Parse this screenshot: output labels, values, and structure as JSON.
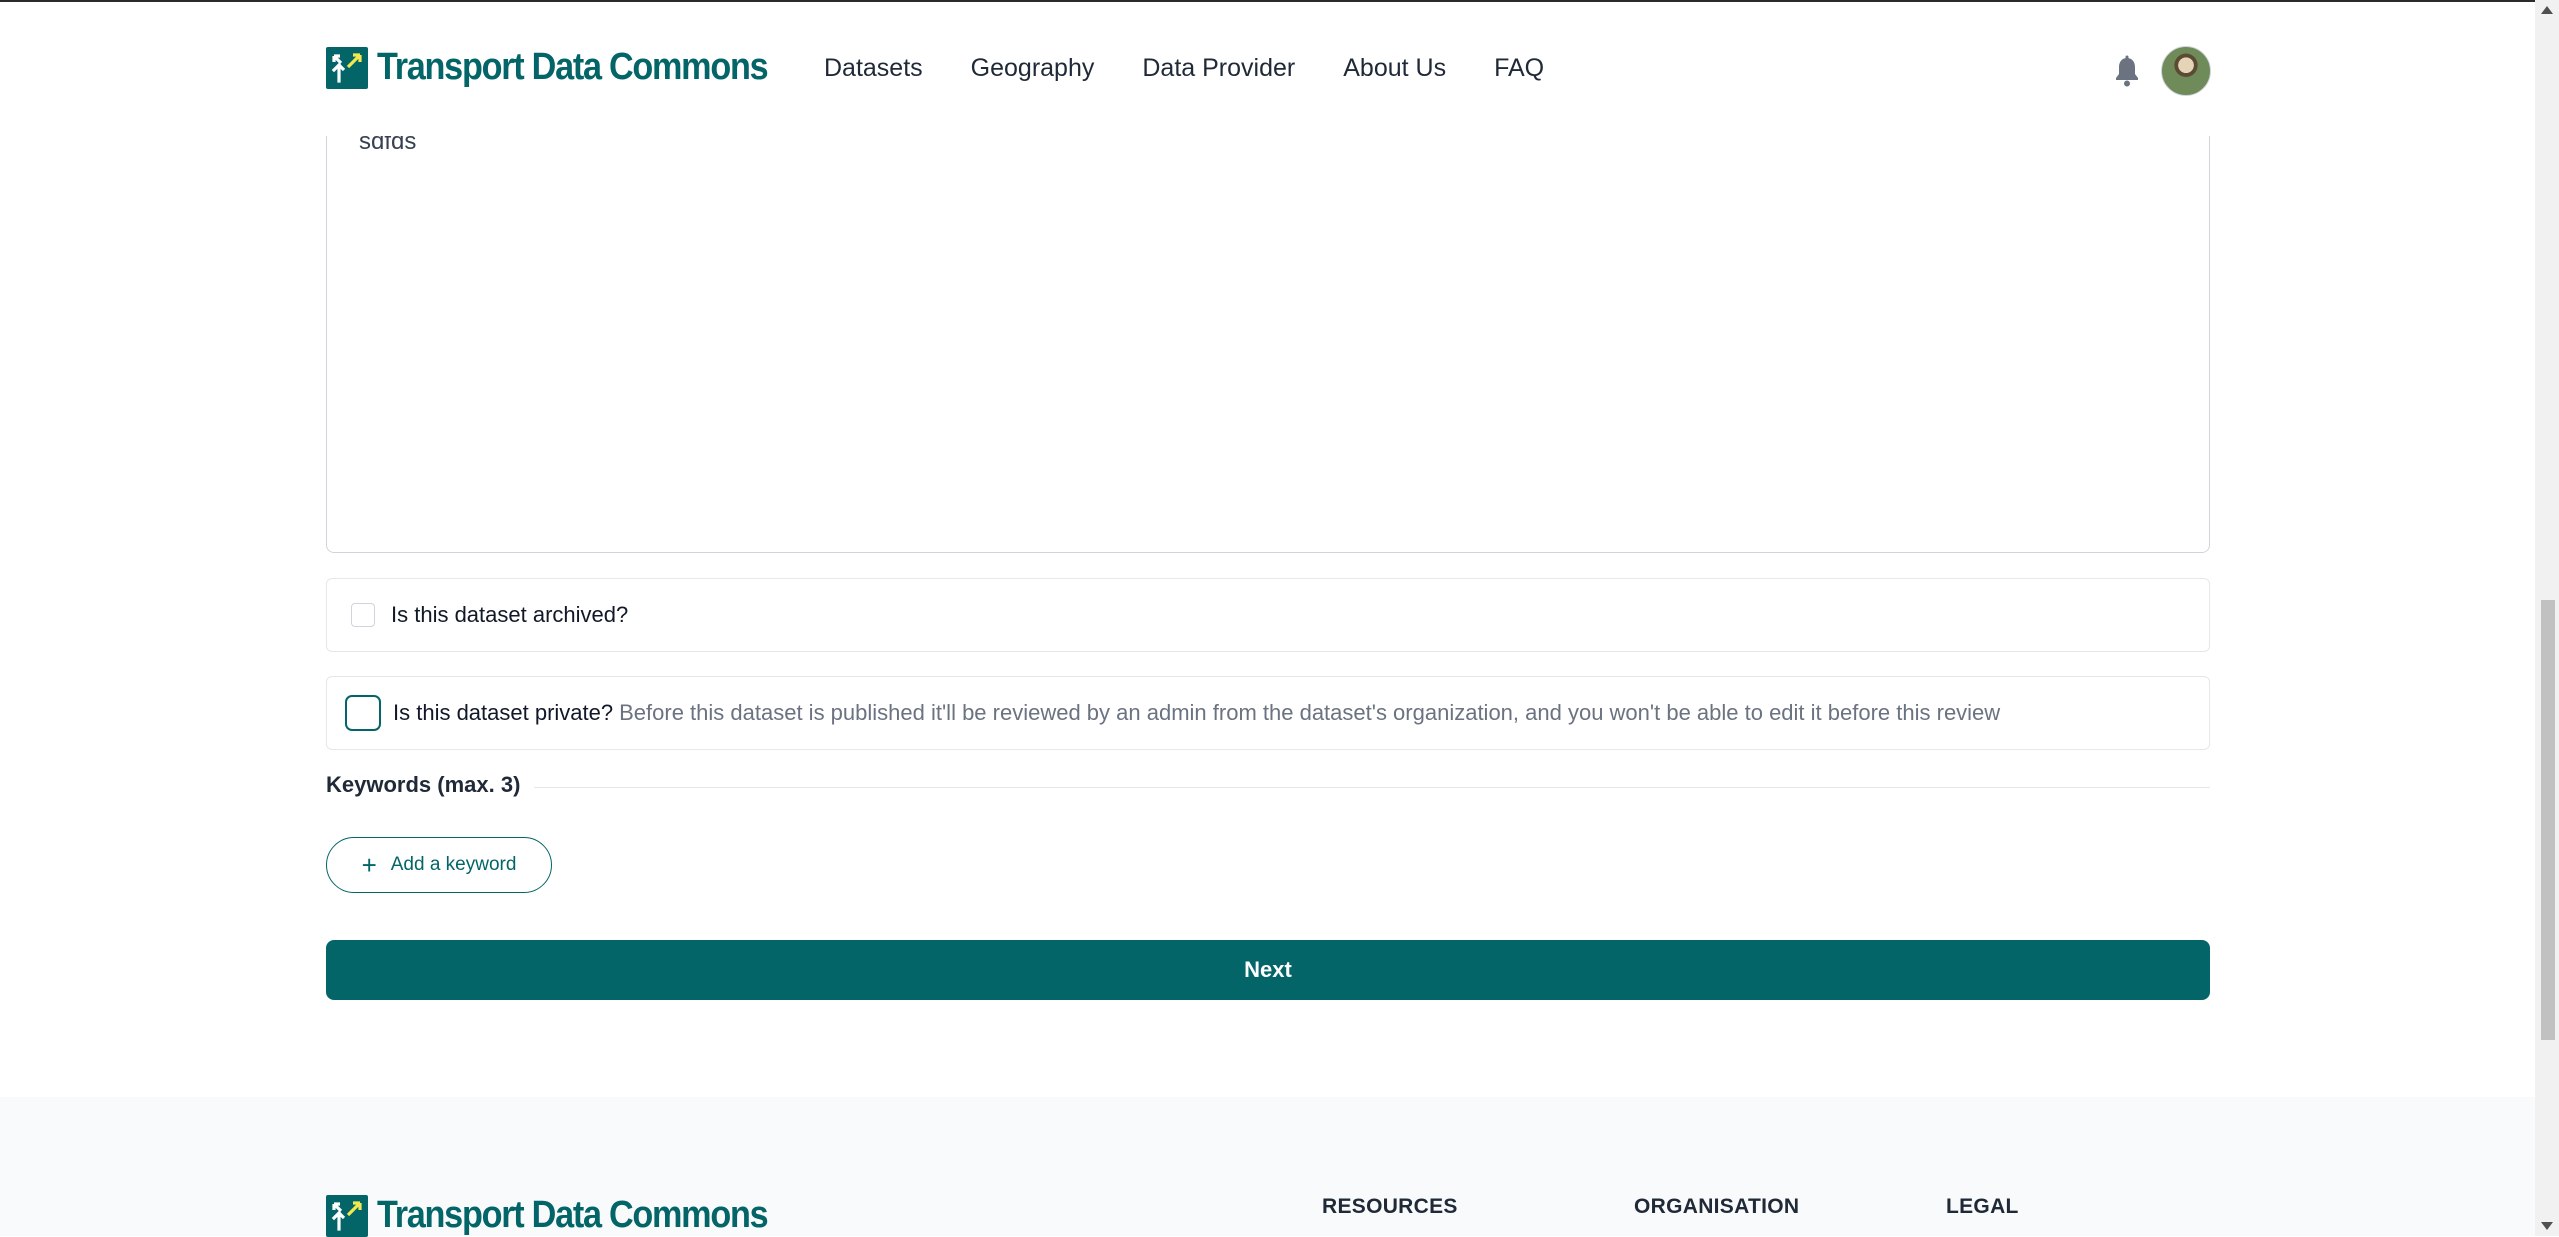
{
  "header": {
    "logo_text": "Transport Data Commons",
    "nav": [
      "Datasets",
      "Geography",
      "Data Provider",
      "About Us",
      "FAQ"
    ],
    "bell_icon": "bell-icon",
    "avatar_icon": "user-avatar"
  },
  "form": {
    "description_value": "sdfds",
    "archived_label": "Is this dataset archived?",
    "archived_checked": false,
    "private_label": "Is this dataset private?",
    "private_description": "Before this dataset is published it'll be reviewed by an admin from the dataset's organization, and you won't be able to edit it before this review",
    "private_checked": false,
    "keywords_title": "Keywords (max. 3)",
    "add_keyword_icon": "plus-icon",
    "add_keyword_label": "Add a keyword",
    "next_label": "Next"
  },
  "footer": {
    "logo_text": "Transport Data Commons",
    "columns": [
      "RESOURCES",
      "ORGANISATION",
      "LEGAL"
    ]
  },
  "colors": {
    "brand": "#046569",
    "accent_yellow": "#f2e94e",
    "footer_bg": "#f9fafb"
  }
}
